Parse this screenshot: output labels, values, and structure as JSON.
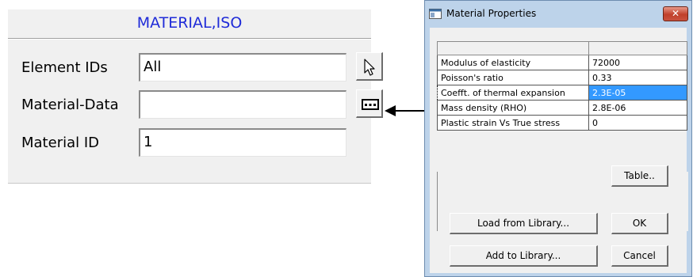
{
  "panel": {
    "title": "MATERIAL,ISO",
    "rows": [
      {
        "label": "Element IDs",
        "value": "All",
        "button_icon": "pointer-arrow-icon"
      },
      {
        "label": "Material-Data",
        "value": "",
        "button_icon": "ellipsis-icon"
      },
      {
        "label": "Material ID",
        "value": "1"
      }
    ]
  },
  "dialog": {
    "title": "Material Properties",
    "close_label": "✕",
    "properties": [
      {
        "name": "Modulus of elasticity",
        "value": "72000"
      },
      {
        "name": "Poisson's ratio",
        "value": "0.33"
      },
      {
        "name": "Coefft. of thermal expansion",
        "value": "2.3E-05",
        "selected": true
      },
      {
        "name": "Mass density (RHO)",
        "value": "2.8E-06"
      },
      {
        "name": "Plastic strain Vs True stress",
        "value": "0"
      }
    ],
    "buttons": {
      "table": "Table..",
      "load_library": "Load from Library...",
      "ok": "OK",
      "add_library": "Add to Library...",
      "cancel": "Cancel"
    }
  },
  "colors": {
    "title_blue": "#1f2bd8",
    "selection": "#3399ff",
    "close_red": "#c0402b"
  }
}
